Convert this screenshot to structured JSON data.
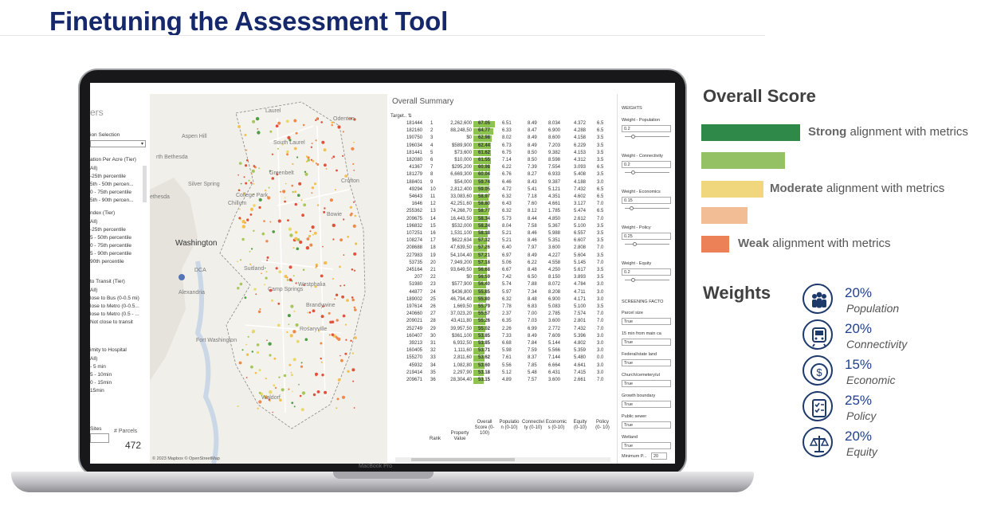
{
  "title": "Finetuning the Assessment Tool",
  "laptop_brand": "MacBook Pro",
  "filters": {
    "title": "ers",
    "selection_label": "ion Selection",
    "density_label": "ation Per Acre (Tier)",
    "density_items": [
      "All)",
      "-25th percentile",
      "5th - 50th percen...",
      "0 - 75th percentile",
      "5th - 90th percen..."
    ],
    "index_label": "ndex (Tier)",
    "index_items": [
      "All)",
      "-25th percentile",
      "5 - 50th percentile",
      "0 - 75th percentile",
      "5 - 90th percentile",
      "90th percentile"
    ],
    "transit_label": "to Transit (Tier)",
    "transit_items": [
      "All)",
      "lose to Bus (0-0.5 mi)",
      "lose to Metro (0-0.5...",
      "lose to Metro (0.5 - ...",
      "Not close to transit"
    ],
    "hospital_label": "imity to Hospital",
    "hospital_items": [
      "All)",
      "- 5 min",
      "5 - 10min",
      "0 - 15min",
      "15min"
    ],
    "sites_label": "Sites",
    "parcels_label": "# Parcels",
    "parcels_count": "472"
  },
  "map": {
    "labels": [
      "Laurel",
      "Odenton",
      "Aspen Hill",
      "South Laurel",
      "rth Bethesda",
      "Silver Spring",
      "Greenbelt",
      "Crofton",
      "ethesda",
      "College Park",
      "Chillum",
      "Bowie",
      "Washington",
      "Suitland",
      "Westphalia",
      "Alexandria",
      "Camp Springs",
      "Brandywine",
      "Fort Washington",
      "Rosaryville",
      "Waldorf",
      "DCA"
    ],
    "attribution": "© 2023 Mapbox  © OpenStreetMap"
  },
  "summary": {
    "title": "Overall Summary",
    "target_label": "Target..",
    "rows": [
      [
        "181444",
        "1",
        "2,262,600",
        "67.05",
        "6.51",
        "8.49",
        "8.034",
        "4.372",
        "6.5"
      ],
      [
        "182160",
        "2",
        "88,248,50",
        "64.77",
        "6.33",
        "8.47",
        "6.900",
        "4.288",
        "6.5"
      ],
      [
        "190750",
        "3",
        "$0",
        "62.98",
        "8.02",
        "8.49",
        "8.600",
        "4.158",
        "3.5"
      ],
      [
        "196034",
        "4",
        "$589,900",
        "62.44",
        "6.73",
        "8.49",
        "7.203",
        "6.229",
        "3.5"
      ],
      [
        "181441",
        "5",
        "$73,600",
        "61.62",
        "6.75",
        "8.50",
        "9.382",
        "4.153",
        "3.5"
      ],
      [
        "182080",
        "6",
        "$10,000",
        "61.55",
        "7.14",
        "8.50",
        "8.598",
        "4.312",
        "3.5"
      ],
      [
        "41367",
        "7",
        "$295,200",
        "60.98",
        "6.22",
        "7.39",
        "7.554",
        "3.093",
        "6.5"
      ],
      [
        "181279",
        "8",
        "6,669,300",
        "60.04",
        "6.76",
        "8.27",
        "6.933",
        "5.408",
        "3.5"
      ],
      [
        "188401",
        "9",
        "$54,000",
        "59.74",
        "6.46",
        "8.43",
        "9.387",
        "4.188",
        "3.0"
      ],
      [
        "49294",
        "10",
        "2,812,400",
        "59.05",
        "4.72",
        "5.41",
        "5.121",
        "7.432",
        "6.5"
      ],
      [
        "54643",
        "11",
        "33,083,60",
        "58.97",
        "6.32",
        "7.18",
        "4.351",
        "4.602",
        "6.5"
      ],
      [
        "1646",
        "12",
        "42,251,60",
        "58.80",
        "6.43",
        "7.60",
        "4.661",
        "3.127",
        "7.0"
      ],
      [
        "255362",
        "13",
        "74,268,70",
        "58.77",
        "6.32",
        "8.12",
        "1.785",
        "5.474",
        "6.5"
      ],
      [
        "209675",
        "14",
        "16,443,50",
        "58.34",
        "5.73",
        "8.44",
        "4.850",
        "2.612",
        "7.0"
      ],
      [
        "196832",
        "15",
        "$532,000",
        "58.24",
        "8.04",
        "7.58",
        "5.367",
        "5.100",
        "3.5"
      ],
      [
        "107251",
        "16",
        "1,531,100",
        "58.18",
        "5.21",
        "8.46",
        "5.988",
        "6.557",
        "3.5"
      ],
      [
        "108274",
        "17",
        "$622,634",
        "57.32",
        "5.21",
        "8.46",
        "5.351",
        "6.607",
        "3.5"
      ],
      [
        "208688",
        "18",
        "47,639,50",
        "57.26",
        "6.40",
        "7.97",
        "3.600",
        "2.808",
        "7.0"
      ],
      [
        "227983",
        "19",
        "54,104,40",
        "57.21",
        "6.97",
        "8.49",
        "4.227",
        "5.604",
        "3.5"
      ],
      [
        "53735",
        "20",
        "7,949,200",
        "57.18",
        "5.06",
        "6.22",
        "4.558",
        "5.145",
        "7.0"
      ],
      [
        "245164",
        "21",
        "93,649,50",
        "56.68",
        "6.67",
        "8.48",
        "4.250",
        "5.617",
        "3.5"
      ],
      [
        "207",
        "22",
        "$0",
        "56.59",
        "7.42",
        "6.50",
        "8.150",
        "3.893",
        "3.5"
      ],
      [
        "51980",
        "23",
        "$577,900",
        "56.40",
        "5.74",
        "7.88",
        "8.072",
        "4.784",
        "3.0"
      ],
      [
        "44877",
        "24",
        "$436,800",
        "55.85",
        "5.97",
        "7.34",
        "8.208",
        "4.711",
        "3.0"
      ],
      [
        "189002",
        "25",
        "46,794,40",
        "55.80",
        "6.32",
        "8.48",
        "6.900",
        "4.171",
        "3.0"
      ],
      [
        "197614",
        "26",
        "1,669,50",
        "55.79",
        "7.78",
        "6.83",
        "5.083",
        "5.100",
        "3.5"
      ],
      [
        "240660",
        "27",
        "37,023,20",
        "55.57",
        "2.37",
        "7.00",
        "2.785",
        "7.574",
        "7.0"
      ],
      [
        "209021",
        "28",
        "43,411,80",
        "55.26",
        "6.35",
        "7.03",
        "3.600",
        "2.801",
        "7.0"
      ],
      [
        "252749",
        "29",
        "39,957,50",
        "55.02",
        "2.26",
        "6.99",
        "2.772",
        "7.432",
        "7.0"
      ],
      [
        "160407",
        "30",
        "$361,100",
        "53.85",
        "7.33",
        "8.49",
        "7.609",
        "5.396",
        "3.0"
      ],
      [
        "39213",
        "31",
        "6,932,50",
        "53.85",
        "6.68",
        "7.84",
        "5.144",
        "4.802",
        "3.0"
      ],
      [
        "160405",
        "32",
        "1,111,60",
        "53.71",
        "5.98",
        "7.59",
        "5.566",
        "5.359",
        "3.0"
      ],
      [
        "155270",
        "33",
        "2,811,60",
        "53.62",
        "7.61",
        "8.37",
        "7.144",
        "5.480",
        "0.0"
      ],
      [
        "45932",
        "34",
        "1,082,80",
        "53.60",
        "5.56",
        "7.85",
        "6.664",
        "4.641",
        "3.0"
      ],
      [
        "219414",
        "35",
        "2,297,90",
        "53.18",
        "5.12",
        "5.48",
        "6.431",
        "7.415",
        "3.0"
      ],
      [
        "209671",
        "36",
        "28,304,40",
        "53.15",
        "4.89",
        "7.57",
        "3.600",
        "2.661",
        "7.0"
      ]
    ],
    "headers": [
      "Rank",
      "Property Value",
      "Overall Score (0-100)",
      "Populatio n (0-10)",
      "Connectivi ty (0-10)",
      "Economic s (0-10)",
      "Equity (0-10)",
      "Policy (0- 10)"
    ]
  },
  "weights_panel": {
    "title": "WEIGHTS",
    "items": [
      {
        "label": "Weight - Population",
        "value": "0.2"
      },
      {
        "label": "Weight - Connectivity",
        "value": "0.2"
      },
      {
        "label": "Weight - Economics",
        "value": "0.15"
      },
      {
        "label": "Weight - Policy",
        "value": "0.25"
      },
      {
        "label": "Weight - Equity",
        "value": "0.2"
      }
    ],
    "screening_title": "SCREENING FACTO",
    "screening": [
      {
        "label": "Parcel size",
        "value": "True"
      },
      {
        "label": "15 min from main ca",
        "value": "True"
      },
      {
        "label": "Federal/state land",
        "value": "True"
      },
      {
        "label": "Church/cemetery/ut",
        "value": "True"
      },
      {
        "label": "Growth boundary",
        "value": "True"
      },
      {
        "label": "Public sewer",
        "value": "True"
      },
      {
        "label": "Wetland",
        "value": "True"
      }
    ],
    "min_label": "Minimum P...",
    "min_value": "20"
  },
  "legend": {
    "title": "Overall Score",
    "items": [
      {
        "color": "#2f8a4a",
        "bold": "Strong",
        "text": " alignment with metrics",
        "fill": 1.0
      },
      {
        "color": "#94c164",
        "bold": "",
        "text": "",
        "fill": 0.85
      },
      {
        "color": "#f0d77d",
        "bold": "Moderate",
        "text": " alignment with metrics",
        "fill": 0.63
      },
      {
        "color": "#f2bc95",
        "bold": "",
        "text": "",
        "fill": 0.47
      },
      {
        "color": "#ec8157",
        "bold": "Weak",
        "text": " alignment with metrics",
        "fill": 0.28
      }
    ]
  },
  "weights": {
    "title": "Weights",
    "items": [
      {
        "pct": "20%",
        "name": "Population",
        "icon": "people-icon"
      },
      {
        "pct": "20%",
        "name": "Connectivity",
        "icon": "train-icon"
      },
      {
        "pct": "15%",
        "name": "Economic",
        "icon": "money-icon"
      },
      {
        "pct": "25%",
        "name": "Policy",
        "icon": "checklist-icon"
      },
      {
        "pct": "20%",
        "name": "Equity",
        "icon": "scales-icon"
      }
    ]
  }
}
